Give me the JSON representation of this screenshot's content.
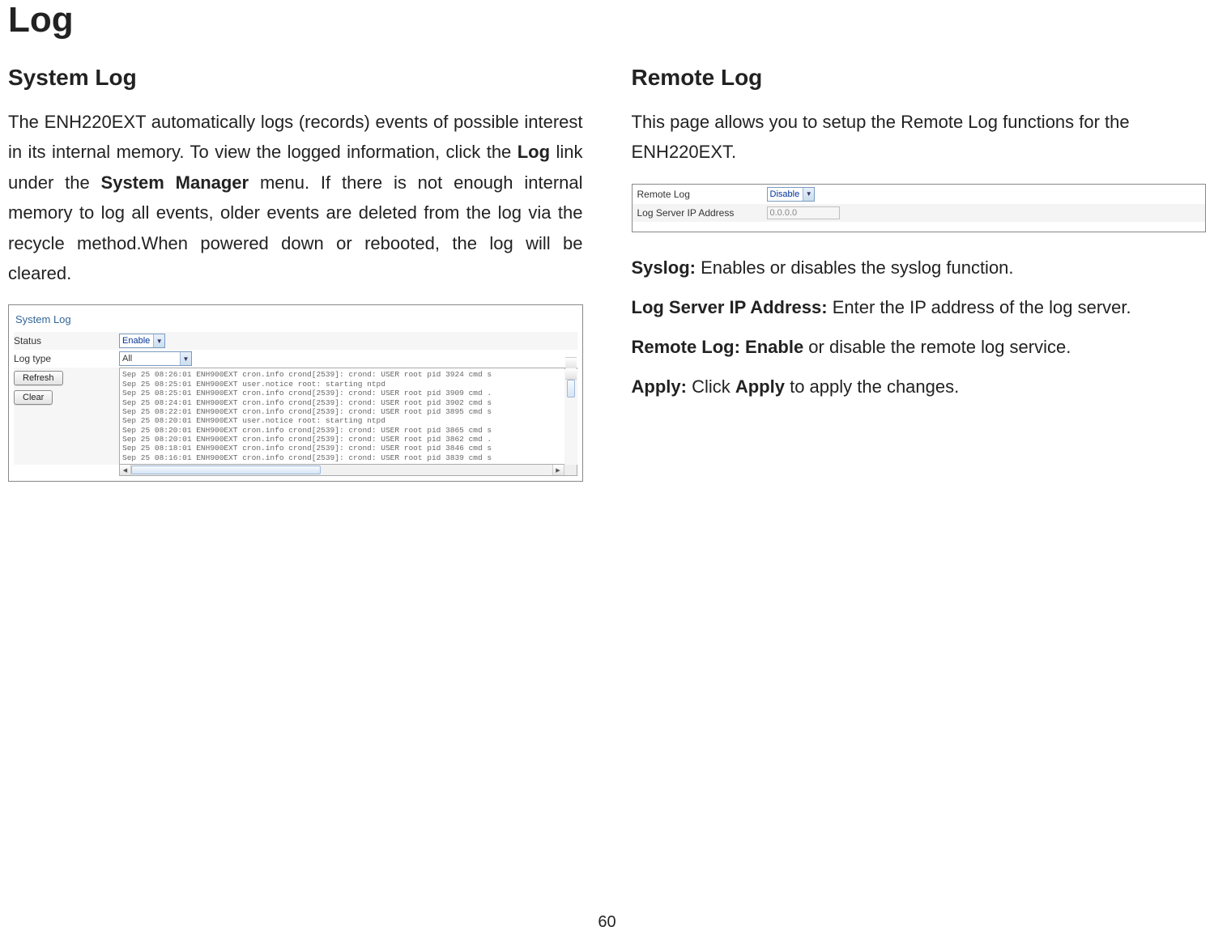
{
  "page_title": "Log",
  "page_number": "60",
  "left": {
    "subhead": "System Log",
    "intro_pre": "The ENH220EXT automatically logs (records) events of possible interest in its internal memory. To view the logged information, click the ",
    "intro_bold1": "Log",
    "intro_mid1": " link under the ",
    "intro_bold2": "System Manager",
    "intro_rest": " menu. If there is not enough internal memory to log all events, older events are deleted from the log via the recycle method.When powered down or rebooted, the log will be cleared.",
    "shot": {
      "title": "System Log",
      "status_label": "Status",
      "status_value": "Enable",
      "logtype_label": "Log type",
      "logtype_value": "All",
      "refresh": "Refresh",
      "clear": "Clear",
      "lines": [
        "Sep 25 08:26:01 ENH900EXT cron.info crond[2539]: crond: USER root pid 3924 cmd s",
        "Sep 25 08:25:01 ENH900EXT user.notice root: starting ntpd",
        "Sep 25 08:25:01 ENH900EXT cron.info crond[2539]: crond: USER root pid 3909 cmd .",
        "Sep 25 08:24:01 ENH900EXT cron.info crond[2539]: crond: USER root pid 3902 cmd s",
        "Sep 25 08:22:01 ENH900EXT cron.info crond[2539]: crond: USER root pid 3895 cmd s",
        "Sep 25 08:20:01 ENH900EXT user.notice root: starting ntpd",
        "Sep 25 08:20:01 ENH900EXT cron.info crond[2539]: crond: USER root pid 3865 cmd s",
        "Sep 25 08:20:01 ENH900EXT cron.info crond[2539]: crond: USER root pid 3862 cmd .",
        "Sep 25 08:18:01 ENH900EXT cron.info crond[2539]: crond: USER root pid 3846 cmd s",
        "Sep 25 08:16:01 ENH900EXT cron.info crond[2539]: crond: USER root pid 3839 cmd s"
      ]
    }
  },
  "right": {
    "subhead": "Remote Log",
    "intro": "This page allows you to setup the Remote Log functions for the ENH220EXT.",
    "shot": {
      "remotelog_label": "Remote Log",
      "remotelog_value": "Disable",
      "ip_label": "Log Server IP Address",
      "ip_value": "0.0.0.0"
    },
    "defs": {
      "syslog_k": "Syslog:",
      "syslog_v": " Enables or disables the syslog function.",
      "ip_k": "Log Server IP Address:",
      "ip_v": " Enter the IP address of the log server.",
      "remote_k": "Remote Log: Enable",
      "remote_v": " or disable the remote log service.",
      "apply_k": "Apply:",
      "apply_mid": " Click ",
      "apply_bold": "Apply",
      "apply_end": " to apply the changes."
    }
  }
}
